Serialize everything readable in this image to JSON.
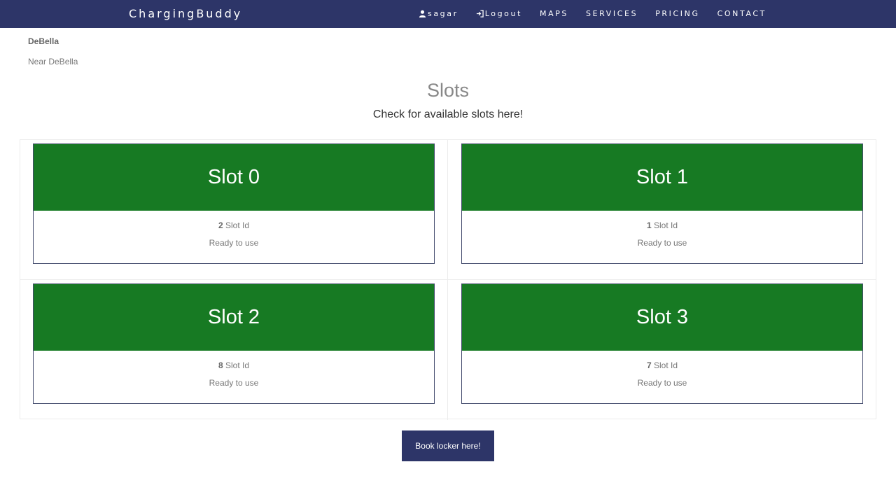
{
  "navbar": {
    "brand": "ChargingBuddy",
    "user_label": "sagar",
    "logout_label": "Logout",
    "links": [
      "MAPS",
      "SERVICES",
      "PRICING",
      "CONTACT"
    ],
    "bg_color": "#2d3568"
  },
  "station": {
    "name": "DeBella",
    "address": "Near DeBella"
  },
  "header": {
    "title": "Slots",
    "subtitle": "Check for available slots here!"
  },
  "slots": [
    {
      "name": "Slot 0",
      "id": "2",
      "id_label": "Slot Id",
      "status": "Ready to use"
    },
    {
      "name": "Slot 1",
      "id": "1",
      "id_label": "Slot Id",
      "status": "Ready to use"
    },
    {
      "name": "Slot 2",
      "id": "8",
      "id_label": "Slot Id",
      "status": "Ready to use"
    },
    {
      "name": "Slot 3",
      "id": "7",
      "id_label": "Slot Id",
      "status": "Ready to use"
    }
  ],
  "slot_color": "#177a23",
  "book_button": "Book locker here!"
}
